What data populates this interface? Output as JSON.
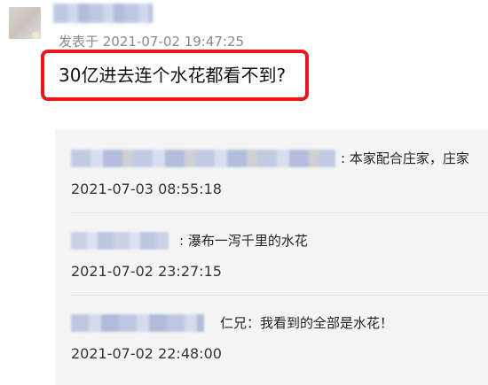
{
  "post": {
    "meta": "发表于 2021-07-02 19:47:25",
    "content": "30亿进去连个水花都看不到?"
  },
  "replies": [
    {
      "text": ": 本家配合庄家，庄家",
      "time": "2021-07-03 08:55:18"
    },
    {
      "text": ": 瀑布一泻千里的水花",
      "time": "2021-07-02 23:27:15"
    },
    {
      "text": "仁兄：我看到的全部是水花！",
      "time": "2021-07-02 22:48:00"
    }
  ],
  "colors": {
    "highlight_border": "#e8171c",
    "reply_bg": "#f5f5f5",
    "meta_text": "#8a8a8a"
  }
}
